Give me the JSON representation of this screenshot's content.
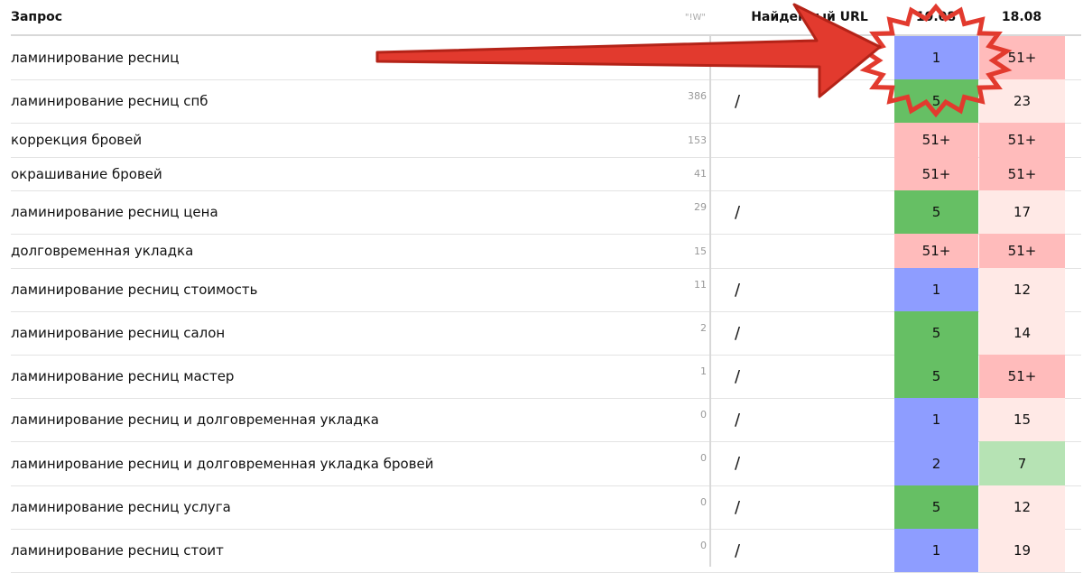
{
  "header": {
    "query": "Запрос",
    "wordstat": "\"!W\"",
    "url": "Найденный URL",
    "date1": "19.08",
    "date2": "18.08"
  },
  "colors": {
    "blue": "#8e9dff",
    "green": "#66bf64",
    "red": "#ffbbbb",
    "lightred": "#ffe9e6",
    "lightgreen": "#b6e3b4",
    "arrow": "#e23a2e"
  },
  "rows": [
    {
      "query": "ламинирование ресниц",
      "wf": "",
      "url": "",
      "d1": "1",
      "d1c": "blue",
      "d2": "51+",
      "d2c": "red"
    },
    {
      "query": "ламинирование ресниц спб",
      "wf": "386",
      "url": "/",
      "d1": "5",
      "d1c": "green",
      "d2": "23",
      "d2c": "lightred"
    },
    {
      "query": "коррекция бровей",
      "wf": "153",
      "url": "",
      "d1": "51+",
      "d1c": "red",
      "d2": "51+",
      "d2c": "red"
    },
    {
      "query": "окрашивание бровей",
      "wf": "41",
      "url": "",
      "d1": "51+",
      "d1c": "red",
      "d2": "51+",
      "d2c": "red"
    },
    {
      "query": "ламинирование ресниц цена",
      "wf": "29",
      "url": "/",
      "d1": "5",
      "d1c": "green",
      "d2": "17",
      "d2c": "lightred"
    },
    {
      "query": "долговременная укладка",
      "wf": "15",
      "url": "",
      "d1": "51+",
      "d1c": "red",
      "d2": "51+",
      "d2c": "red"
    },
    {
      "query": "ламинирование ресниц стоимость",
      "wf": "11",
      "url": "/",
      "d1": "1",
      "d1c": "blue",
      "d2": "12",
      "d2c": "lightred"
    },
    {
      "query": "ламинирование ресниц салон",
      "wf": "2",
      "url": "/",
      "d1": "5",
      "d1c": "green",
      "d2": "14",
      "d2c": "lightred"
    },
    {
      "query": "ламинирование ресниц мастер",
      "wf": "1",
      "url": "/",
      "d1": "5",
      "d1c": "green",
      "d2": "51+",
      "d2c": "red"
    },
    {
      "query": "ламинирование ресниц и долговременная укладка",
      "wf": "0",
      "url": "/",
      "d1": "1",
      "d1c": "blue",
      "d2": "15",
      "d2c": "lightred"
    },
    {
      "query": "ламинирование ресниц и долговременная укладка бровей",
      "wf": "0",
      "url": "/",
      "d1": "2",
      "d1c": "blue",
      "d2": "7",
      "d2c": "lightgreen"
    },
    {
      "query": "ламинирование ресниц услуга",
      "wf": "0",
      "url": "/",
      "d1": "5",
      "d1c": "green",
      "d2": "12",
      "d2c": "lightred"
    },
    {
      "query": "ламинирование ресниц стоит",
      "wf": "0",
      "url": "/",
      "d1": "1",
      "d1c": "blue",
      "d2": "19",
      "d2c": "lightred"
    }
  ]
}
